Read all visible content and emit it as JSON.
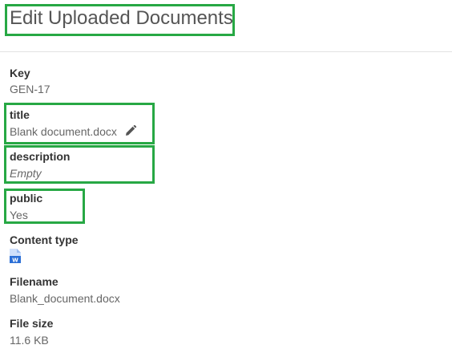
{
  "page": {
    "title": "Edit Uploaded Documents"
  },
  "fields": {
    "key": {
      "label": "Key",
      "value": "GEN-17"
    },
    "title": {
      "label": "title",
      "value": "Blank document.docx"
    },
    "description": {
      "label": "description",
      "value": "Empty"
    },
    "public": {
      "label": "public",
      "value": "Yes"
    },
    "content_type": {
      "label": "Content type",
      "icon": "word-document-icon"
    },
    "filename": {
      "label": "Filename",
      "value": "Blank_document.docx"
    },
    "file_size": {
      "label": "File size",
      "value": "11.6 KB"
    }
  },
  "colors": {
    "highlight": "#27a844",
    "word_blue": "#2b6fd6"
  }
}
